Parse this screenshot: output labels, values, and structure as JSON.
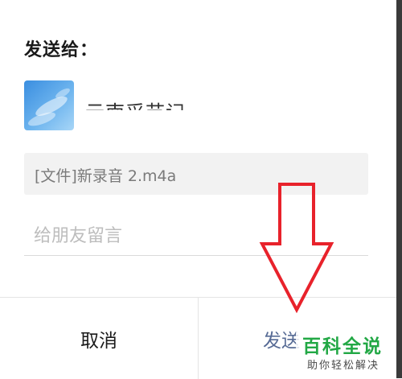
{
  "dialog": {
    "title": "发送给：",
    "recipient": {
      "name": "云南采节记"
    },
    "file_label": "[文件]新录音 2.m4a",
    "message_placeholder": "给朋友留言",
    "buttons": {
      "cancel": "取消",
      "send": "发送"
    }
  },
  "watermark": {
    "main": "百科全说",
    "sub": "助你轻松解决"
  },
  "colors": {
    "arrow": "#e8222b",
    "send_text": "#576b95",
    "watermark_green": "#22a845"
  }
}
